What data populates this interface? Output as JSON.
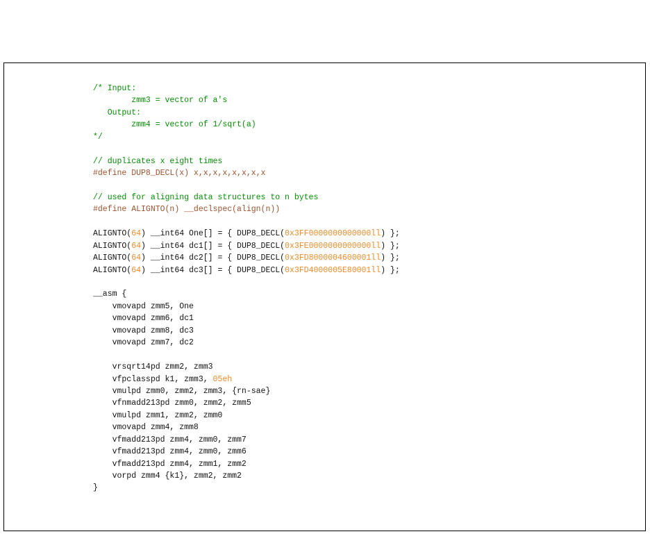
{
  "colors": {
    "comment": "#009000",
    "preprocessor": "#a0522d",
    "number": "#f08a24",
    "code": "#111111",
    "border": "#000000"
  },
  "code": [
    [
      {
        "t": "/* Input:",
        "c": "cmt"
      }
    ],
    [
      {
        "t": "        zmm3 = vector of a's",
        "c": "cmt"
      }
    ],
    [
      {
        "t": "   Output:",
        "c": "cmt"
      }
    ],
    [
      {
        "t": "        zmm4 = vector of 1/sqrt(a)",
        "c": "cmt"
      }
    ],
    [
      {
        "t": "*/",
        "c": "cmt"
      }
    ],
    [],
    [
      {
        "t": "// duplicates x eight times",
        "c": "cmt"
      }
    ],
    [
      {
        "t": "#define",
        "c": "pre"
      },
      {
        "t": " DUP8_DECL(x) x,x,x,x,x,x,x,x",
        "c": "pre"
      }
    ],
    [],
    [
      {
        "t": "// used for aligning data structures to n bytes",
        "c": "cmt"
      }
    ],
    [
      {
        "t": "#define",
        "c": "pre"
      },
      {
        "t": " ALIGNTO(n) __declspec(align(n))",
        "c": "pre"
      }
    ],
    [],
    [
      {
        "t": "ALIGNTO(",
        "c": "txt"
      },
      {
        "t": "64",
        "c": "num"
      },
      {
        "t": ") __int64 One[] = { DUP8_DECL(",
        "c": "txt"
      },
      {
        "t": "0x3FF0000000000000ll",
        "c": "num"
      },
      {
        "t": ") };",
        "c": "txt"
      }
    ],
    [
      {
        "t": "ALIGNTO(",
        "c": "txt"
      },
      {
        "t": "64",
        "c": "num"
      },
      {
        "t": ") __int64 dc1[] = { DUP8_DECL(",
        "c": "txt"
      },
      {
        "t": "0x3FE0000000000000ll",
        "c": "num"
      },
      {
        "t": ") };",
        "c": "txt"
      }
    ],
    [
      {
        "t": "ALIGNTO(",
        "c": "txt"
      },
      {
        "t": "64",
        "c": "num"
      },
      {
        "t": ") __int64 dc2[] = { DUP8_DECL(",
        "c": "txt"
      },
      {
        "t": "0x3FD8000004600001ll",
        "c": "num"
      },
      {
        "t": ") };",
        "c": "txt"
      }
    ],
    [
      {
        "t": "ALIGNTO(",
        "c": "txt"
      },
      {
        "t": "64",
        "c": "num"
      },
      {
        "t": ") __int64 dc3[] = { DUP8_DECL(",
        "c": "txt"
      },
      {
        "t": "0x3FD4000005E80001ll",
        "c": "num"
      },
      {
        "t": ") };",
        "c": "txt"
      }
    ],
    [],
    [
      {
        "t": "__asm {",
        "c": "txt"
      }
    ],
    [
      {
        "t": "    vmovapd zmm5, One",
        "c": "txt"
      }
    ],
    [
      {
        "t": "    vmovapd zmm6, dc1",
        "c": "txt"
      }
    ],
    [
      {
        "t": "    vmovapd zmm8, dc3",
        "c": "txt"
      }
    ],
    [
      {
        "t": "    vmovapd zmm7, dc2",
        "c": "txt"
      }
    ],
    [],
    [
      {
        "t": "    vrsqrt14pd zmm2, zmm3",
        "c": "txt"
      }
    ],
    [
      {
        "t": "    vfpclasspd k1, zmm3, ",
        "c": "txt"
      },
      {
        "t": "05eh",
        "c": "num"
      }
    ],
    [
      {
        "t": "    vmulpd zmm0, zmm2, zmm3, {rn-sae}",
        "c": "txt"
      }
    ],
    [
      {
        "t": "    vfnmadd213pd zmm0, zmm2, zmm5",
        "c": "txt"
      }
    ],
    [
      {
        "t": "    vmulpd zmm1, zmm2, zmm0",
        "c": "txt"
      }
    ],
    [
      {
        "t": "    vmovapd zmm4, zmm8",
        "c": "txt"
      }
    ],
    [
      {
        "t": "    vfmadd213pd zmm4, zmm0, zmm7",
        "c": "txt"
      }
    ],
    [
      {
        "t": "    vfmadd213pd zmm4, zmm0, zmm6",
        "c": "txt"
      }
    ],
    [
      {
        "t": "    vfmadd213pd zmm4, zmm1, zmm2",
        "c": "txt"
      }
    ],
    [
      {
        "t": "    vorpd zmm4 {k1}, zmm2, zmm2",
        "c": "txt"
      }
    ],
    [
      {
        "t": "}",
        "c": "txt"
      }
    ]
  ]
}
